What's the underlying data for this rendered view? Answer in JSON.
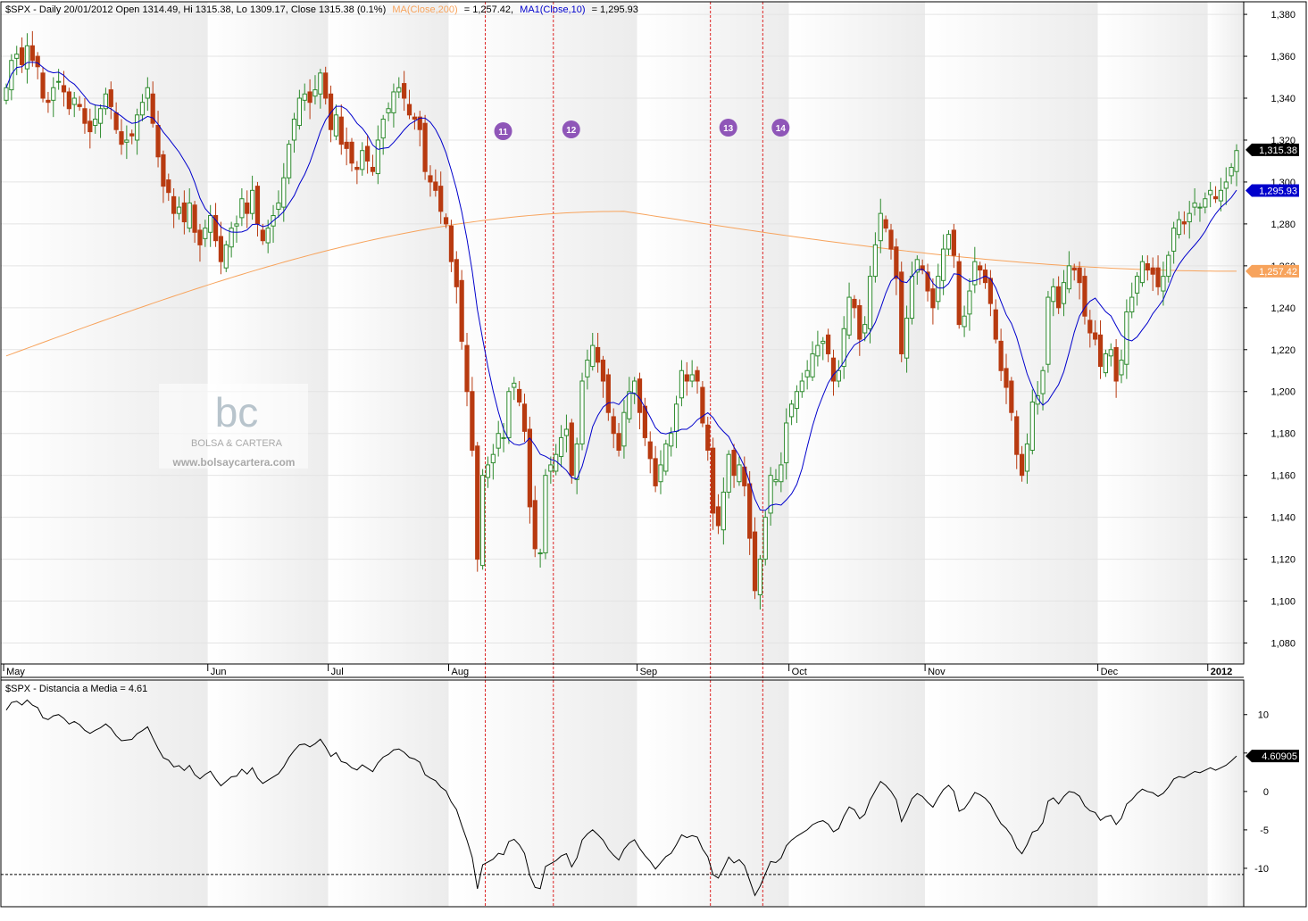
{
  "chart_data": [
    {
      "type": "candlestick",
      "header": {
        "symbol_line": "$SPX - Daily 20/01/2012 Open 1314.49, Hi 1315.38, Lo 1309.17, Close 1315.38 (0.1%)",
        "ma200_label": "MA(Close,200)",
        "ma200_value_text": "= 1,257.42,",
        "ma10_label": "MA1(Close,10)",
        "ma10_value_text": "= 1,295.93"
      },
      "y_ticks": [
        1080,
        1100,
        1120,
        1140,
        1160,
        1180,
        1200,
        1220,
        1240,
        1260,
        1280,
        1300,
        1320,
        1340,
        1360,
        1380
      ],
      "y_tick_labels": [
        "1,080",
        "1,100",
        "1,120",
        "1,140",
        "1,160",
        "1,180",
        "1,200",
        "1,220",
        "1,240",
        "1,260",
        "1,280",
        "1,300",
        "1,320",
        "1,340",
        "1,360",
        "1,380"
      ],
      "ylim": [
        1070,
        1386
      ],
      "x_labels": [
        "May",
        "Jun",
        "Jul",
        "Aug",
        "Sep",
        "Oct",
        "Nov",
        "Dec",
        "2012"
      ],
      "value_tags": [
        {
          "text": "1,315.38",
          "value": 1315.38,
          "color": "#000000"
        },
        {
          "text": "1,295.93",
          "value": 1295.93,
          "color": "#0000cc"
        },
        {
          "text": "1,257.42",
          "value": 1257.42,
          "color": "#f7a35c"
        }
      ],
      "event_markers": [
        "11",
        "12",
        "13",
        "14"
      ],
      "closes": [
        1345,
        1358,
        1361,
        1356,
        1365,
        1358,
        1355,
        1340,
        1338,
        1345,
        1348,
        1343,
        1335,
        1340,
        1336,
        1328,
        1324,
        1330,
        1335,
        1342,
        1336,
        1325,
        1318,
        1320,
        1322,
        1332,
        1338,
        1345,
        1328,
        1312,
        1298,
        1295,
        1285,
        1288,
        1281,
        1290,
        1276,
        1270,
        1278,
        1284,
        1272,
        1262,
        1270,
        1278,
        1280,
        1292,
        1285,
        1296,
        1280,
        1272,
        1278,
        1284,
        1290,
        1302,
        1318,
        1330,
        1340,
        1342,
        1338,
        1344,
        1352,
        1340,
        1325,
        1332,
        1318,
        1316,
        1309,
        1306,
        1315,
        1310,
        1305,
        1320,
        1330,
        1335,
        1343,
        1345,
        1340,
        1332,
        1330,
        1325,
        1305,
        1300,
        1296,
        1286,
        1280,
        1262,
        1250,
        1224,
        1200,
        1172,
        1120,
        1160,
        1165,
        1170,
        1180,
        1178,
        1200,
        1204,
        1195,
        1181,
        1145,
        1125,
        1123,
        1160,
        1165,
        1170,
        1178,
        1182,
        1160,
        1175,
        1205,
        1215,
        1222,
        1214,
        1205,
        1190,
        1180,
        1172,
        1190,
        1200,
        1205,
        1190,
        1178,
        1168,
        1155,
        1165,
        1175,
        1180,
        1194,
        1210,
        1205,
        1208,
        1205,
        1185,
        1172,
        1142,
        1136,
        1152,
        1170,
        1160,
        1165,
        1155,
        1130,
        1105,
        1120,
        1140,
        1160,
        1158,
        1165,
        1185,
        1194,
        1200,
        1205,
        1210,
        1218,
        1222,
        1224,
        1218,
        1205,
        1210,
        1230,
        1245,
        1240,
        1225,
        1232,
        1255,
        1270,
        1285,
        1278,
        1268,
        1254,
        1218,
        1235,
        1255,
        1263,
        1258,
        1248,
        1240,
        1255,
        1268,
        1275,
        1265,
        1232,
        1236,
        1248,
        1262,
        1258,
        1252,
        1242,
        1225,
        1210,
        1202,
        1190,
        1170,
        1160,
        1175,
        1195,
        1198,
        1210,
        1245,
        1250,
        1240,
        1252,
        1260,
        1258,
        1252,
        1236,
        1228,
        1225,
        1212,
        1218,
        1220,
        1205,
        1215,
        1238,
        1245,
        1255,
        1262,
        1258,
        1256,
        1250,
        1255,
        1265,
        1278,
        1282,
        1280,
        1285,
        1290,
        1288,
        1292,
        1296,
        1292,
        1296,
        1300,
        1307,
        1315
      ],
      "series": [
        {
          "name": "MA(Close,200)",
          "color": "#f7a35c",
          "start": 1217,
          "peak_index": 118,
          "peak": 1286,
          "end": 1257.42
        },
        {
          "name": "MA1(Close,10)",
          "color": "#0000cc",
          "end": 1295.93
        }
      ],
      "colors": {
        "up": "#2e8b2e",
        "down": "#b83a10",
        "bg_band": "#f0f0f0",
        "event_line": "#dd2222",
        "marker": "#8f56b8"
      },
      "watermark": {
        "text": "bc",
        "line1": "BOLSA & CARTERA",
        "line2": "www.bolsaycartera.com"
      }
    },
    {
      "type": "line",
      "title": "$SPX - Distancia a Media = 4.61",
      "y_ticks": [
        10,
        5,
        0,
        -5,
        -10
      ],
      "y_tick_labels": [
        "10",
        "5",
        "0",
        "-5",
        "-10"
      ],
      "ylim": [
        -15,
        14.5
      ],
      "reference_line": -10.8,
      "last_value_text": "4.60905",
      "last_value": 4.61
    }
  ]
}
